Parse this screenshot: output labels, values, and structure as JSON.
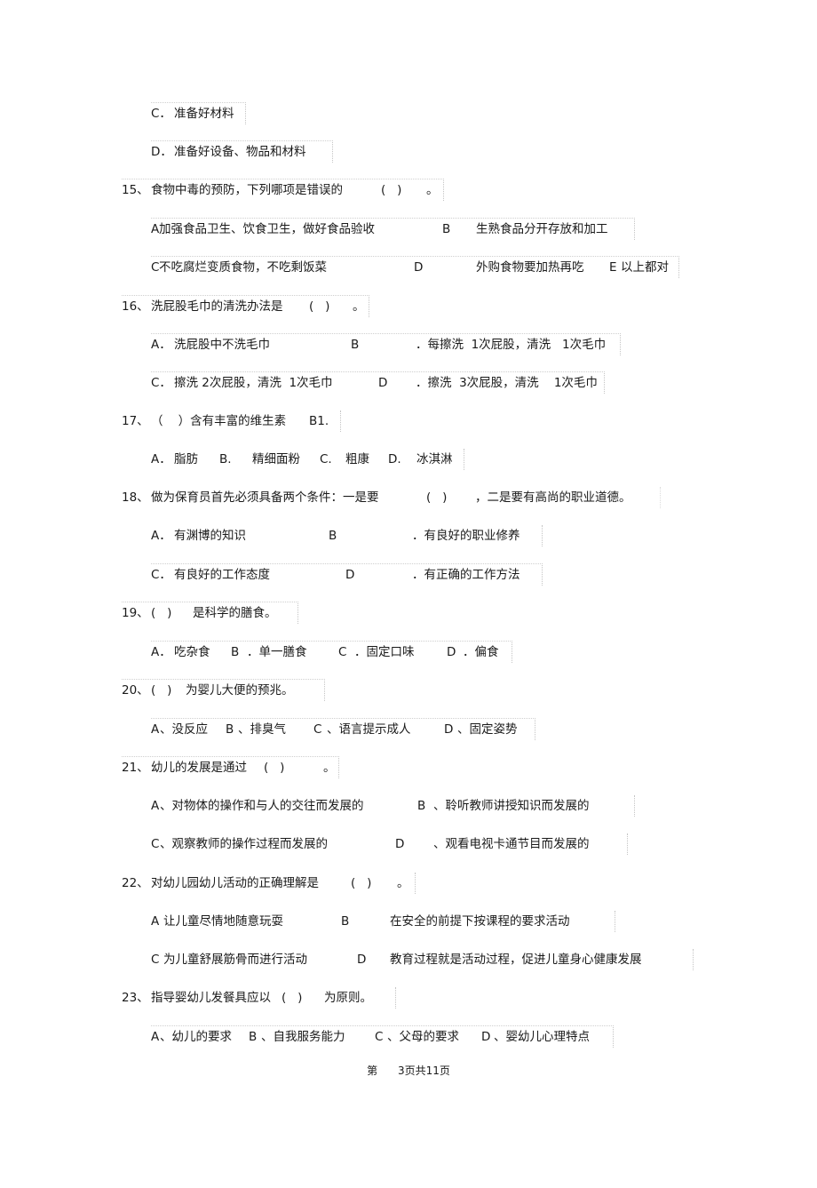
{
  "page": {
    "q14_tail": {
      "options": [
        {
          "label": "C．",
          "text": "准备好材料"
        },
        {
          "label": "D．",
          "text": "准备好设备、物品和材料"
        }
      ]
    },
    "questions": [
      {
        "number": "15、",
        "stem": "食物中毒的预防，下列哪项是错误的",
        "blank": "(   )",
        "end": "。",
        "option_rows": [
          [
            {
              "label": "A",
              "text": "加强食品卫生、饮食卫生，做好食品验收"
            },
            {
              "label": "B",
              "text": "生熟食品分开存放和加工"
            }
          ],
          [
            {
              "label": "C",
              "text": "不吃腐烂变质食物，不吃剩饭菜"
            },
            {
              "label": "D",
              "text": "外购食物要加热再吃"
            },
            {
              "label": "E",
              "text": "以上都对"
            }
          ]
        ]
      },
      {
        "number": "16、",
        "stem": "洗屁股毛巾的清洗办法是",
        "blank": "(   )",
        "end": "。",
        "option_rows": [
          [
            {
              "label": "A．",
              "text": "洗屁股中不洗毛巾"
            },
            {
              "label": "B",
              "text": "．每擦洗  1次屁股，清洗   1次毛巾"
            }
          ],
          [
            {
              "label": "C．",
              "text": "擦洗 2次屁股，清洗  1次毛巾"
            },
            {
              "label": "D",
              "text": "．擦洗  3次屁股，清洗    1次毛巾"
            }
          ]
        ]
      },
      {
        "number": "17、",
        "stem": "（    ）含有丰富的维生素",
        "blank": "",
        "end": "B1.",
        "option_rows": [
          [
            {
              "label": "A．",
              "text": "脂肪"
            },
            {
              "label": "B.",
              "text": "精细面粉"
            },
            {
              "label": "C.",
              "text": "粗康"
            },
            {
              "label": "D.",
              "text": "冰淇淋"
            }
          ]
        ]
      },
      {
        "number": "18、",
        "stem": "做为保育员首先必须具备两个条件：一是要",
        "blank": "(   )",
        "end": "，二是要有高尚的职业道德。",
        "option_rows": [
          [
            {
              "label": "A．",
              "text": "有渊博的知识"
            },
            {
              "label": "B",
              "text": "．有良好的职业修养"
            }
          ],
          [
            {
              "label": "C．",
              "text": "有良好的工作态度"
            },
            {
              "label": "D",
              "text": "．有正确的工作方法"
            }
          ]
        ]
      },
      {
        "number": "19、",
        "stem": "(   )",
        "blank": "",
        "end": "是科学的膳食。",
        "option_rows": [
          [
            {
              "label": "A．",
              "text": "吃杂食"
            },
            {
              "label": "B",
              "text": "．单一膳食"
            },
            {
              "label": "C",
              "text": "．固定口味"
            },
            {
              "label": "D",
              "text": "．偏食"
            }
          ]
        ]
      },
      {
        "number": "20、",
        "stem": "(   )",
        "blank": "",
        "end": "为婴儿大便的预兆。",
        "option_rows": [
          [
            {
              "label": "A",
              "text": "、没反应"
            },
            {
              "label": "B",
              "text": "、排臭气"
            },
            {
              "label": "C",
              "text": "、语言提示成人"
            },
            {
              "label": "D",
              "text": "、固定姿势"
            }
          ]
        ]
      },
      {
        "number": "21、",
        "stem": "幼儿的发展是通过",
        "blank": "(   )",
        "end": "。",
        "option_rows": [
          [
            {
              "label": "A",
              "text": "、对物体的操作和与人的交往而发展的"
            },
            {
              "label": "B",
              "text": "、聆听教师讲授知识而发展的"
            }
          ],
          [
            {
              "label": "C",
              "text": "、观察教师的操作过程而发展的"
            },
            {
              "label": "D",
              "text": "、观看电视卡通节目而发展的"
            }
          ]
        ]
      },
      {
        "number": "22、",
        "stem": "对幼儿园幼儿活动的正确理解是",
        "blank": "(   )",
        "end": "。",
        "option_rows": [
          [
            {
              "label": "A",
              "text": "让儿童尽情地随意玩耍"
            },
            {
              "label": "B",
              "text": "在安全的前提下按课程的要求活动"
            }
          ],
          [
            {
              "label": "C",
              "text": "为儿童舒展筋骨而进行活动"
            },
            {
              "label": "D",
              "text": "教育过程就是活动过程，促进儿童身心健康发展"
            }
          ]
        ]
      },
      {
        "number": "23、",
        "stem": "指导婴幼儿发餐具应以",
        "blank": "(   )",
        "end": "为原则。",
        "option_rows": [
          [
            {
              "label": "A",
              "text": "、幼儿的要求"
            },
            {
              "label": "B",
              "text": "、自我服务能力"
            },
            {
              "label": "C",
              "text": "、父母的要求"
            },
            {
              "label": "D",
              "text": "、婴幼儿心理特点"
            }
          ]
        ]
      }
    ],
    "footer": {
      "prefix": "第",
      "current": "3",
      "middle": "页共",
      "total": "11",
      "suffix": "页"
    }
  }
}
